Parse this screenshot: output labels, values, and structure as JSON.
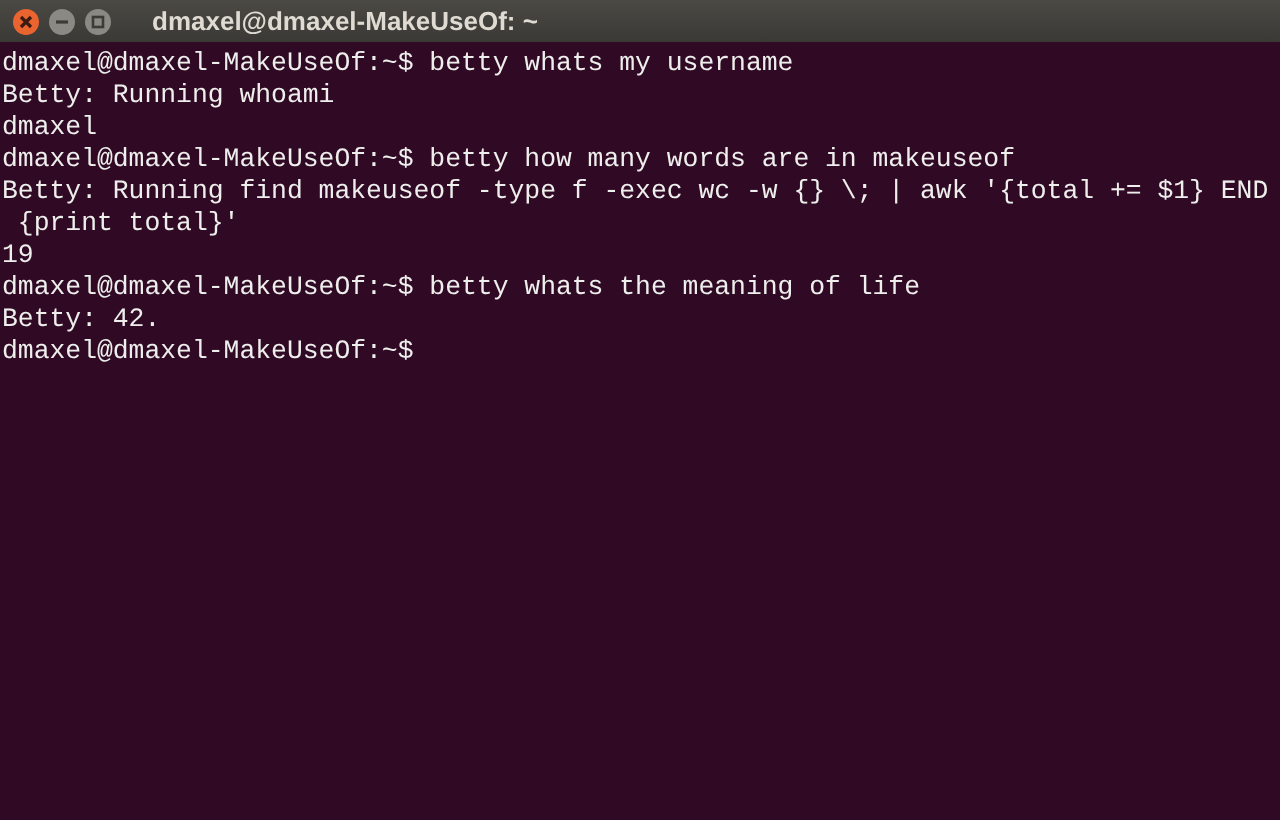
{
  "window": {
    "title": "dmaxel@dmaxel-MakeUseOf: ~"
  },
  "terminal": {
    "lines": [
      "dmaxel@dmaxel-MakeUseOf:~$ betty whats my username",
      "Betty: Running whoami",
      "dmaxel",
      "dmaxel@dmaxel-MakeUseOf:~$ betty how many words are in makeuseof",
      "Betty: Running find makeuseof -type f -exec wc -w {} \\; | awk '{total += $1} END",
      " {print total}'",
      "19",
      "dmaxel@dmaxel-MakeUseOf:~$ betty whats the meaning of life",
      "Betty: 42.",
      "dmaxel@dmaxel-MakeUseOf:~$"
    ]
  }
}
